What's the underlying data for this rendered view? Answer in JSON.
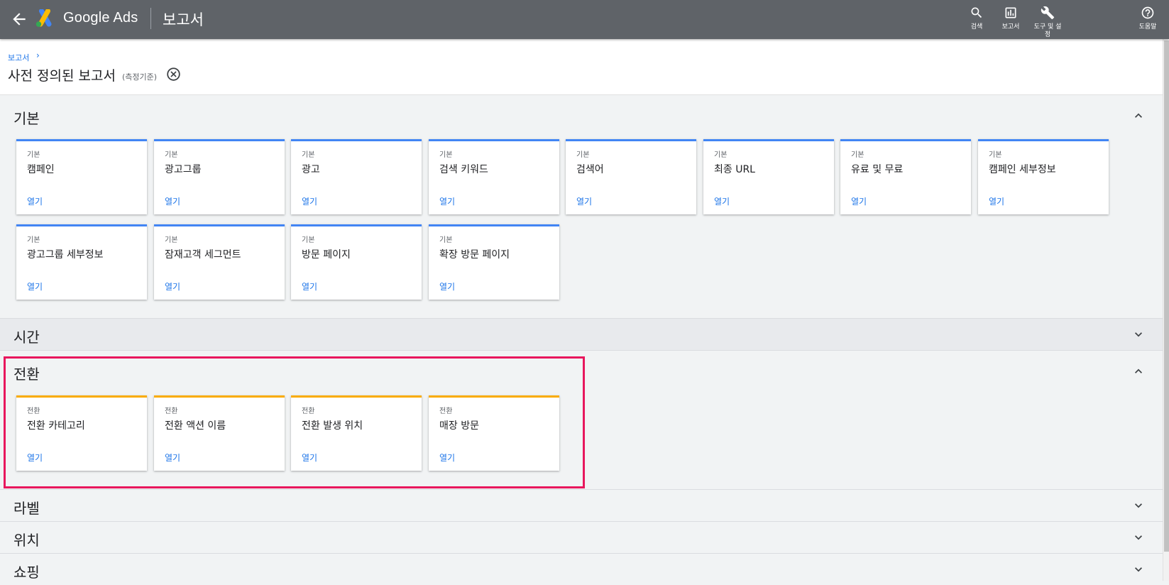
{
  "app": {
    "brand": "Google Ads",
    "page_name": "보고서",
    "icons": {
      "back": "arrow-back-icon",
      "logo": "google-ads-logo-icon"
    }
  },
  "toolbar": [
    {
      "label": "검색",
      "icon": "search-icon"
    },
    {
      "label": "보고서",
      "icon": "reports-icon"
    },
    {
      "label": "도구 및 설정",
      "icon": "wrench-icon"
    },
    {
      "label": "도움말",
      "icon": "help-icon"
    }
  ],
  "breadcrumb": {
    "label": "보고서",
    "chevron": "›"
  },
  "page": {
    "title": "사전 정의된 보고서",
    "title_note": "(측정기준)"
  },
  "sections": [
    {
      "title": "기본",
      "expanded": true,
      "accent": "#4285f4",
      "cards": [
        {
          "category": "기본",
          "name": "캠페인",
          "action": "열기"
        },
        {
          "category": "기본",
          "name": "광고그룹",
          "action": "열기"
        },
        {
          "category": "기본",
          "name": "광고",
          "action": "열기"
        },
        {
          "category": "기본",
          "name": "검색 키워드",
          "action": "열기"
        },
        {
          "category": "기본",
          "name": "검색어",
          "action": "열기"
        },
        {
          "category": "기본",
          "name": "최종 URL",
          "action": "열기"
        },
        {
          "category": "기본",
          "name": "유료 및 무료",
          "action": "열기"
        },
        {
          "category": "기본",
          "name": "캠페인 세부정보",
          "action": "열기"
        },
        {
          "category": "기본",
          "name": "광고그룹 세부정보",
          "action": "열기"
        },
        {
          "category": "기본",
          "name": "잠재고객 세그먼트",
          "action": "열기"
        },
        {
          "category": "기본",
          "name": "방문 페이지",
          "action": "열기"
        },
        {
          "category": "기본",
          "name": "확장 방문 페이지",
          "action": "열기"
        }
      ]
    },
    {
      "title": "시간",
      "expanded": false
    },
    {
      "title": "전환",
      "expanded": true,
      "accent": "#f9ab00",
      "cards": [
        {
          "category": "전환",
          "name": "전환 카테고리",
          "action": "열기"
        },
        {
          "category": "전환",
          "name": "전환 액션 이름",
          "action": "열기"
        },
        {
          "category": "전환",
          "name": "전환 발생 위치",
          "action": "열기"
        },
        {
          "category": "전환",
          "name": "매장 방문",
          "action": "열기"
        }
      ]
    },
    {
      "title": "라벨",
      "expanded": false
    },
    {
      "title": "위치",
      "expanded": false
    },
    {
      "title": "쇼핑",
      "expanded": false
    }
  ],
  "colors": {
    "topbar": "#5f6368",
    "link": "#1a73e8",
    "highlight": "#e8175d"
  }
}
